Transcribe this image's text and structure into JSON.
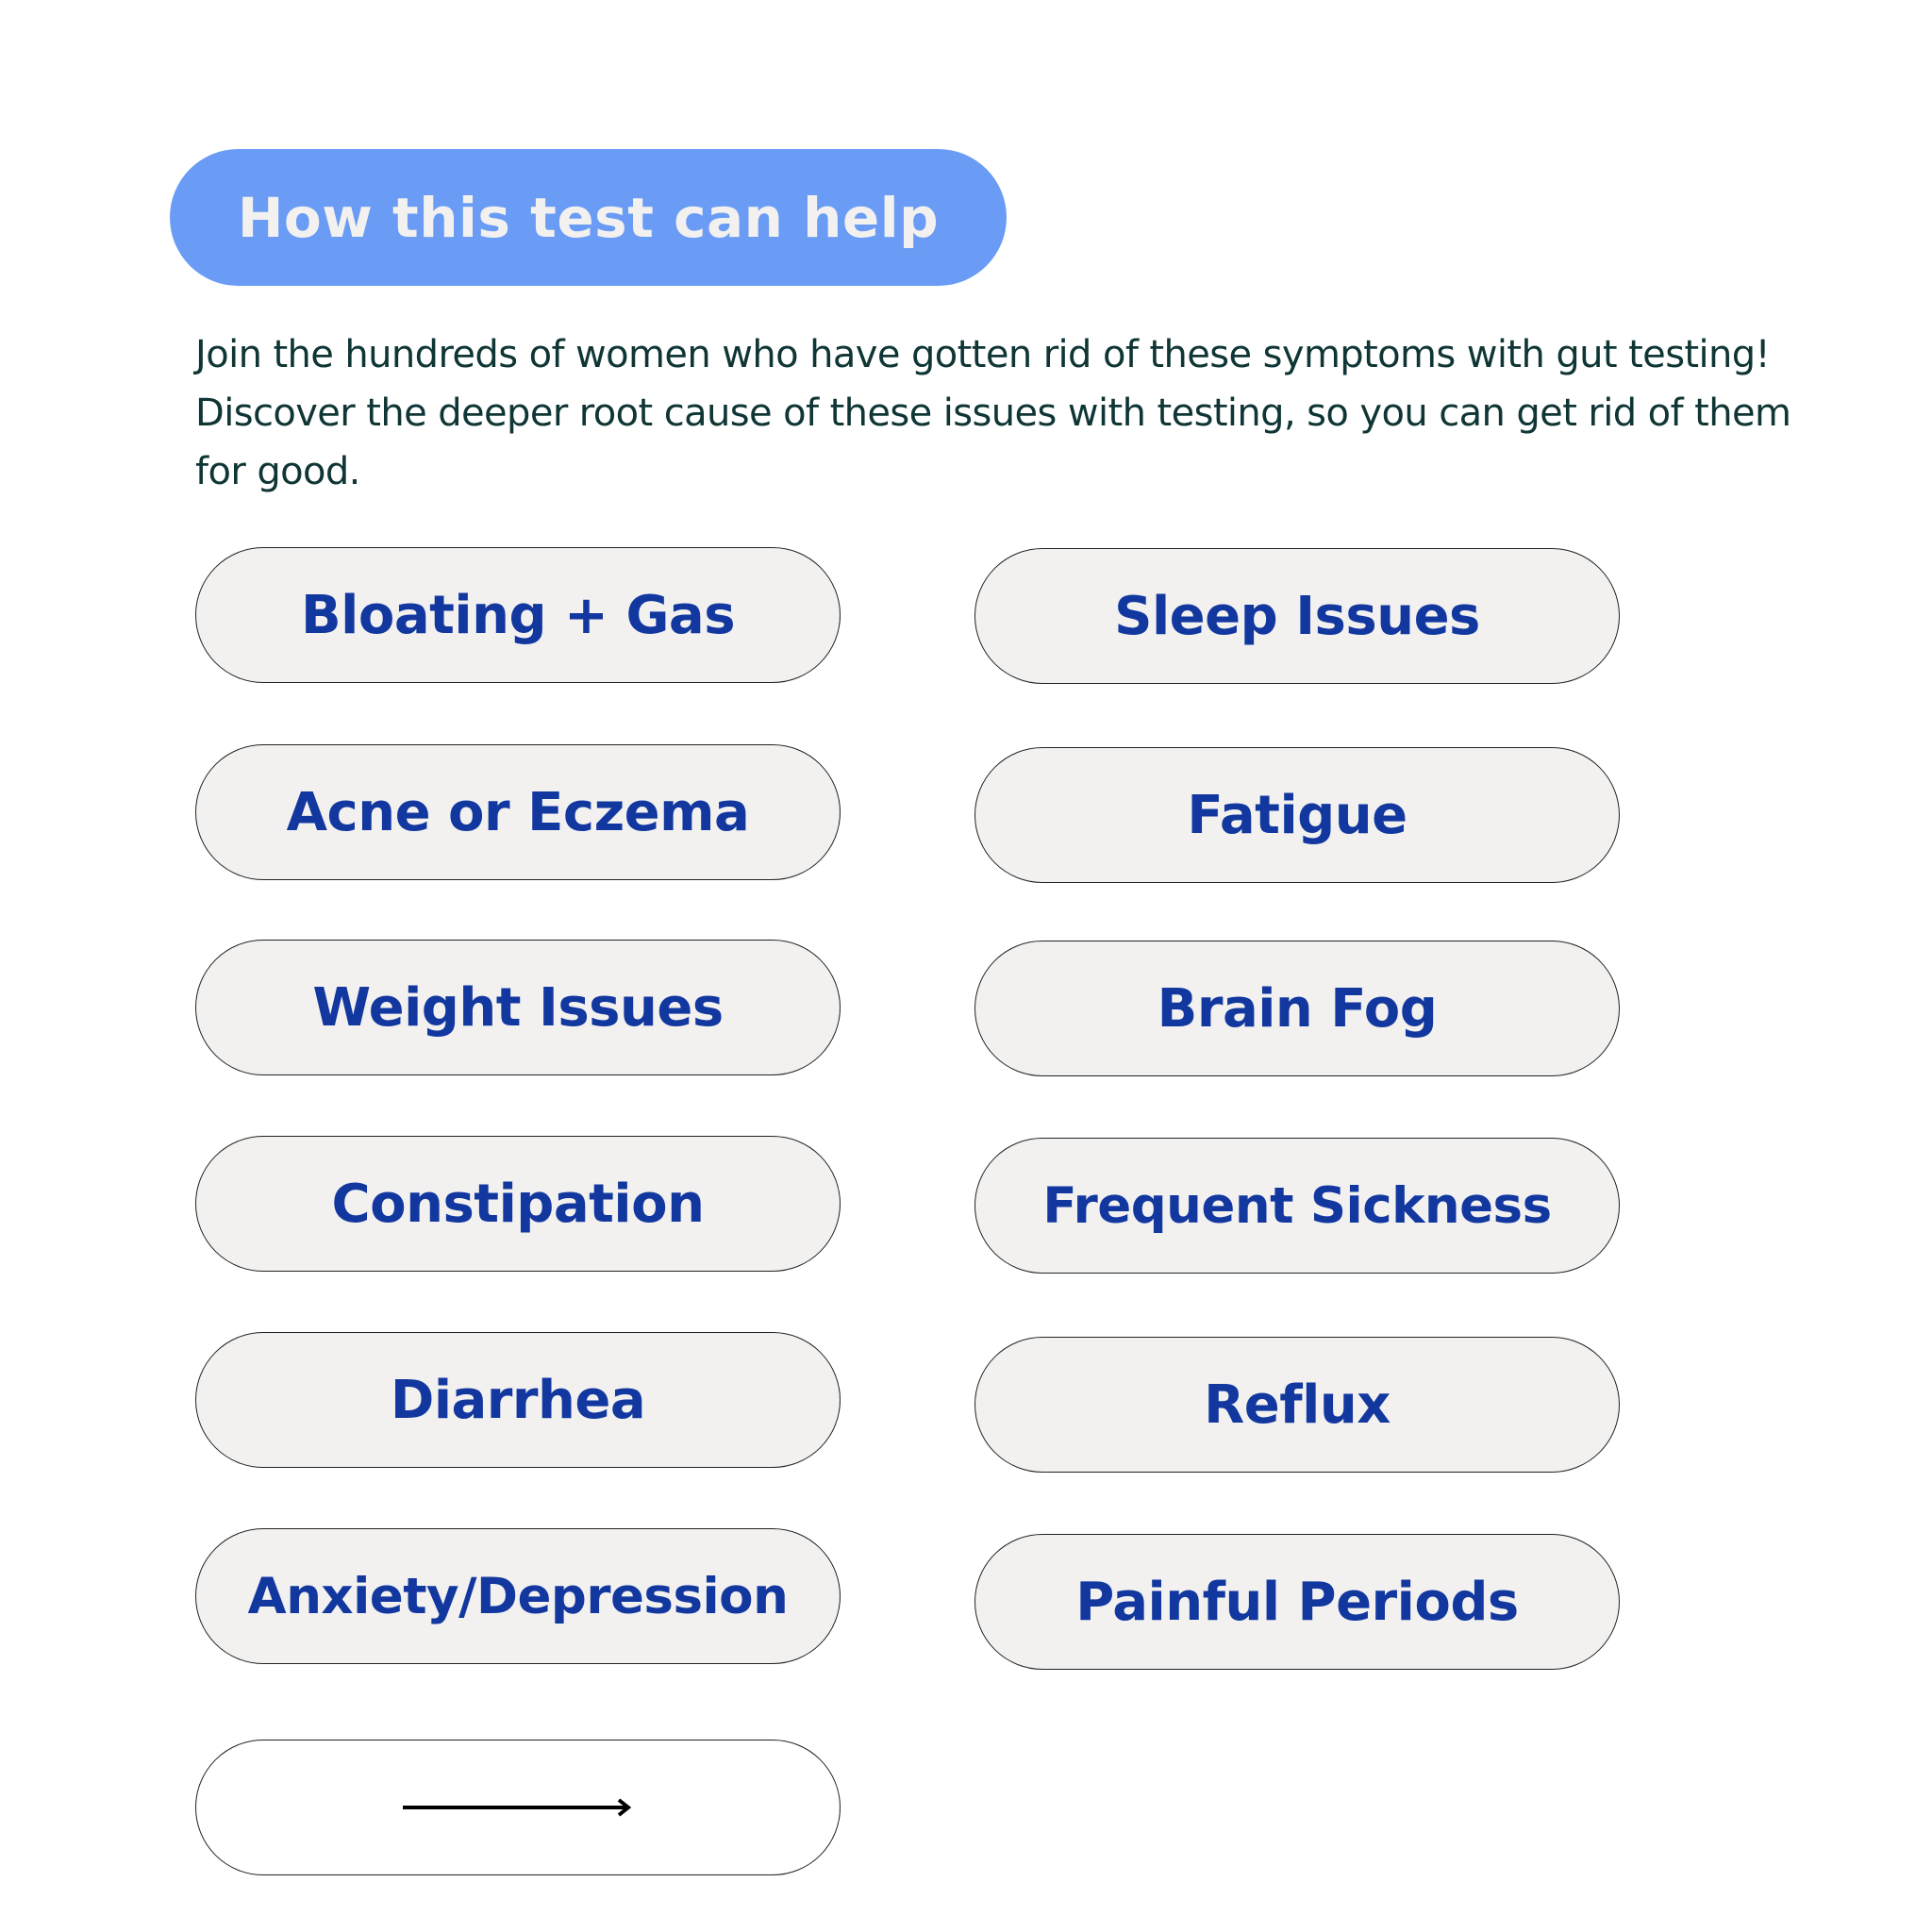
{
  "header": {
    "title": "How this test can help",
    "accent_color": "#6a9cf5"
  },
  "intro": {
    "text": "Join the hundreds of women who have gotten rid of these symptoms with gut testing! Discover the deeper root cause of these issues with testing, so you can get rid of them for good."
  },
  "symptoms": {
    "left": [
      {
        "label": "Bloating + Gas"
      },
      {
        "label": "Acne or Eczema"
      },
      {
        "label": "Weight Issues"
      },
      {
        "label": "Constipation"
      },
      {
        "label": "Diarrhea"
      },
      {
        "label": "Anxiety/Depression"
      }
    ],
    "right": [
      {
        "label": "Sleep Issues"
      },
      {
        "label": "Fatigue"
      },
      {
        "label": "Brain Fog"
      },
      {
        "label": "Frequent Sickness"
      },
      {
        "label": "Reflux"
      },
      {
        "label": "Painful Periods"
      }
    ],
    "text_color": "#1238a0",
    "pill_color": "#f2f1f0"
  },
  "next_button": {
    "icon": "arrow-right-icon"
  }
}
